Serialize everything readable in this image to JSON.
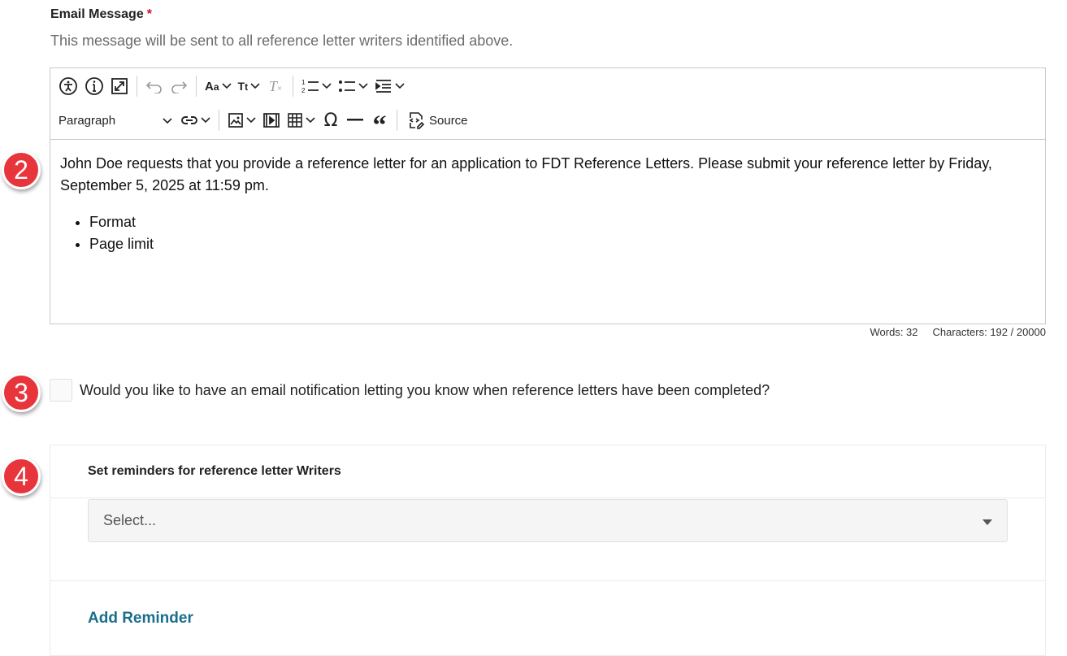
{
  "email_message": {
    "label": "Email Message",
    "required_marker": "*",
    "help_text": "This message will be sent to all reference letter writers identified above."
  },
  "editor": {
    "toolbar": {
      "paragraph_select": "Paragraph",
      "source_label": "Source",
      "icons": [
        "accessibility-icon",
        "info-icon",
        "fullscreen-icon",
        "undo-icon",
        "redo-icon",
        "font-family-icon",
        "font-size-icon",
        "remove-format-icon",
        "numbered-list-icon",
        "bulleted-list-icon",
        "indent-icon",
        "link-icon",
        "image-icon",
        "media-icon",
        "table-icon",
        "special-character-icon",
        "horizontal-line-icon",
        "blockquote-icon",
        "source-icon"
      ]
    },
    "content": {
      "paragraph": "John Doe requests that you provide a reference letter for an application to FDT Reference Letters. Please submit your reference letter by Friday, September 5, 2025 at 11:59 pm.",
      "bullets": [
        "Format",
        "Page limit"
      ]
    },
    "counter": {
      "words": "Words: 32",
      "characters": "Characters: 192 / 20000"
    }
  },
  "badges": [
    "2",
    "3",
    "4"
  ],
  "notification": {
    "label": "Would you like to have an email notification letting you know when reference letters have been completed?",
    "checked": false
  },
  "reminders": {
    "title": "Set reminders for reference letter Writers",
    "select_placeholder": "Select...",
    "add_label": "Add Reminder"
  },
  "colors": {
    "badge": "#e8353c",
    "link": "#1a6e8a",
    "required": "#c8102e"
  }
}
